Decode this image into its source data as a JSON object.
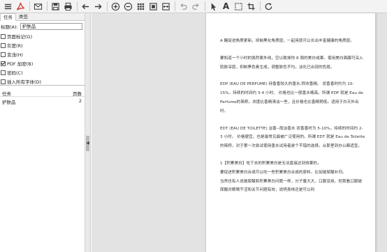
{
  "left_panel": {
    "tabs": [
      "任务",
      "类签"
    ],
    "title_label": "标题(A):",
    "title_value": "护肤品",
    "options": [
      {
        "label": "页面标记(G)",
        "checked": false
      },
      {
        "label": "灰度(R)",
        "checked": false
      },
      {
        "label": "变浅(H)",
        "checked": false
      },
      {
        "label": "PDF 加密(B)",
        "checked": true
      },
      {
        "label": "密码(C)",
        "checked": false
      },
      {
        "label": "插入所有字体(D)",
        "checked": false
      }
    ],
    "task_header": {
      "task": "任务",
      "pages": "页数"
    },
    "tasks": [
      {
        "name": "护肤品",
        "pages": "2"
      }
    ]
  },
  "document": {
    "paragraphs": [
      "A 酪促进角质更新，抑制黑化角质层，一起用就可以长出丰富健康的角质层。",
      "要知道一个小时的强烈紫外线，空以致掉你 8 周的美白成果。使用美白面膜可深入肌肤深层，抑制黑色素生成，调整肤色不均，淡化已出现的色斑。",
      "EDP (EAU DE PERFUME) 持香香较久的香水,称浓香精。 状香香时约为 10-15%。持续的时间约 3-4 小时。 价格也比一般香水略高。所谓 EDP 就是 Eau de Perfume的简称。浓度比香精清淡一些，且价格也比香精稍低。适用于白天外出时。",
      "EDT (EAU DE TOILETTE) 淡香--般淡香水 状香香时为 5-10%，持续的时间约 2-3 小时。 价格便宜，也是最常见最被广泛使用的。所谓 EDT 就是 Eau de Toilette的简称，对于第一次尝试使用香水试用者是个不错的选择，从那里到办公都适宜。",
      "1【积累美白】吃下去的积累美白是无法直接达到效果的，\n要促进积累美白合成可以吃一些积累美白合成的原料，比如玻尿酸补剂。\n当然也有人说玻尿酸和积累美白问题一样，分子量大大，口服没用。但我看口服玻尿酸对眼睛干涩和关节问题有效，说明身体还是可以利"
    ]
  },
  "colors": {
    "toolbar_bg": "#f3f3f3",
    "viewer_bg": "#e3e3e3",
    "pdf_red": "#d9342b",
    "icon_dark": "#3d3d3d"
  }
}
